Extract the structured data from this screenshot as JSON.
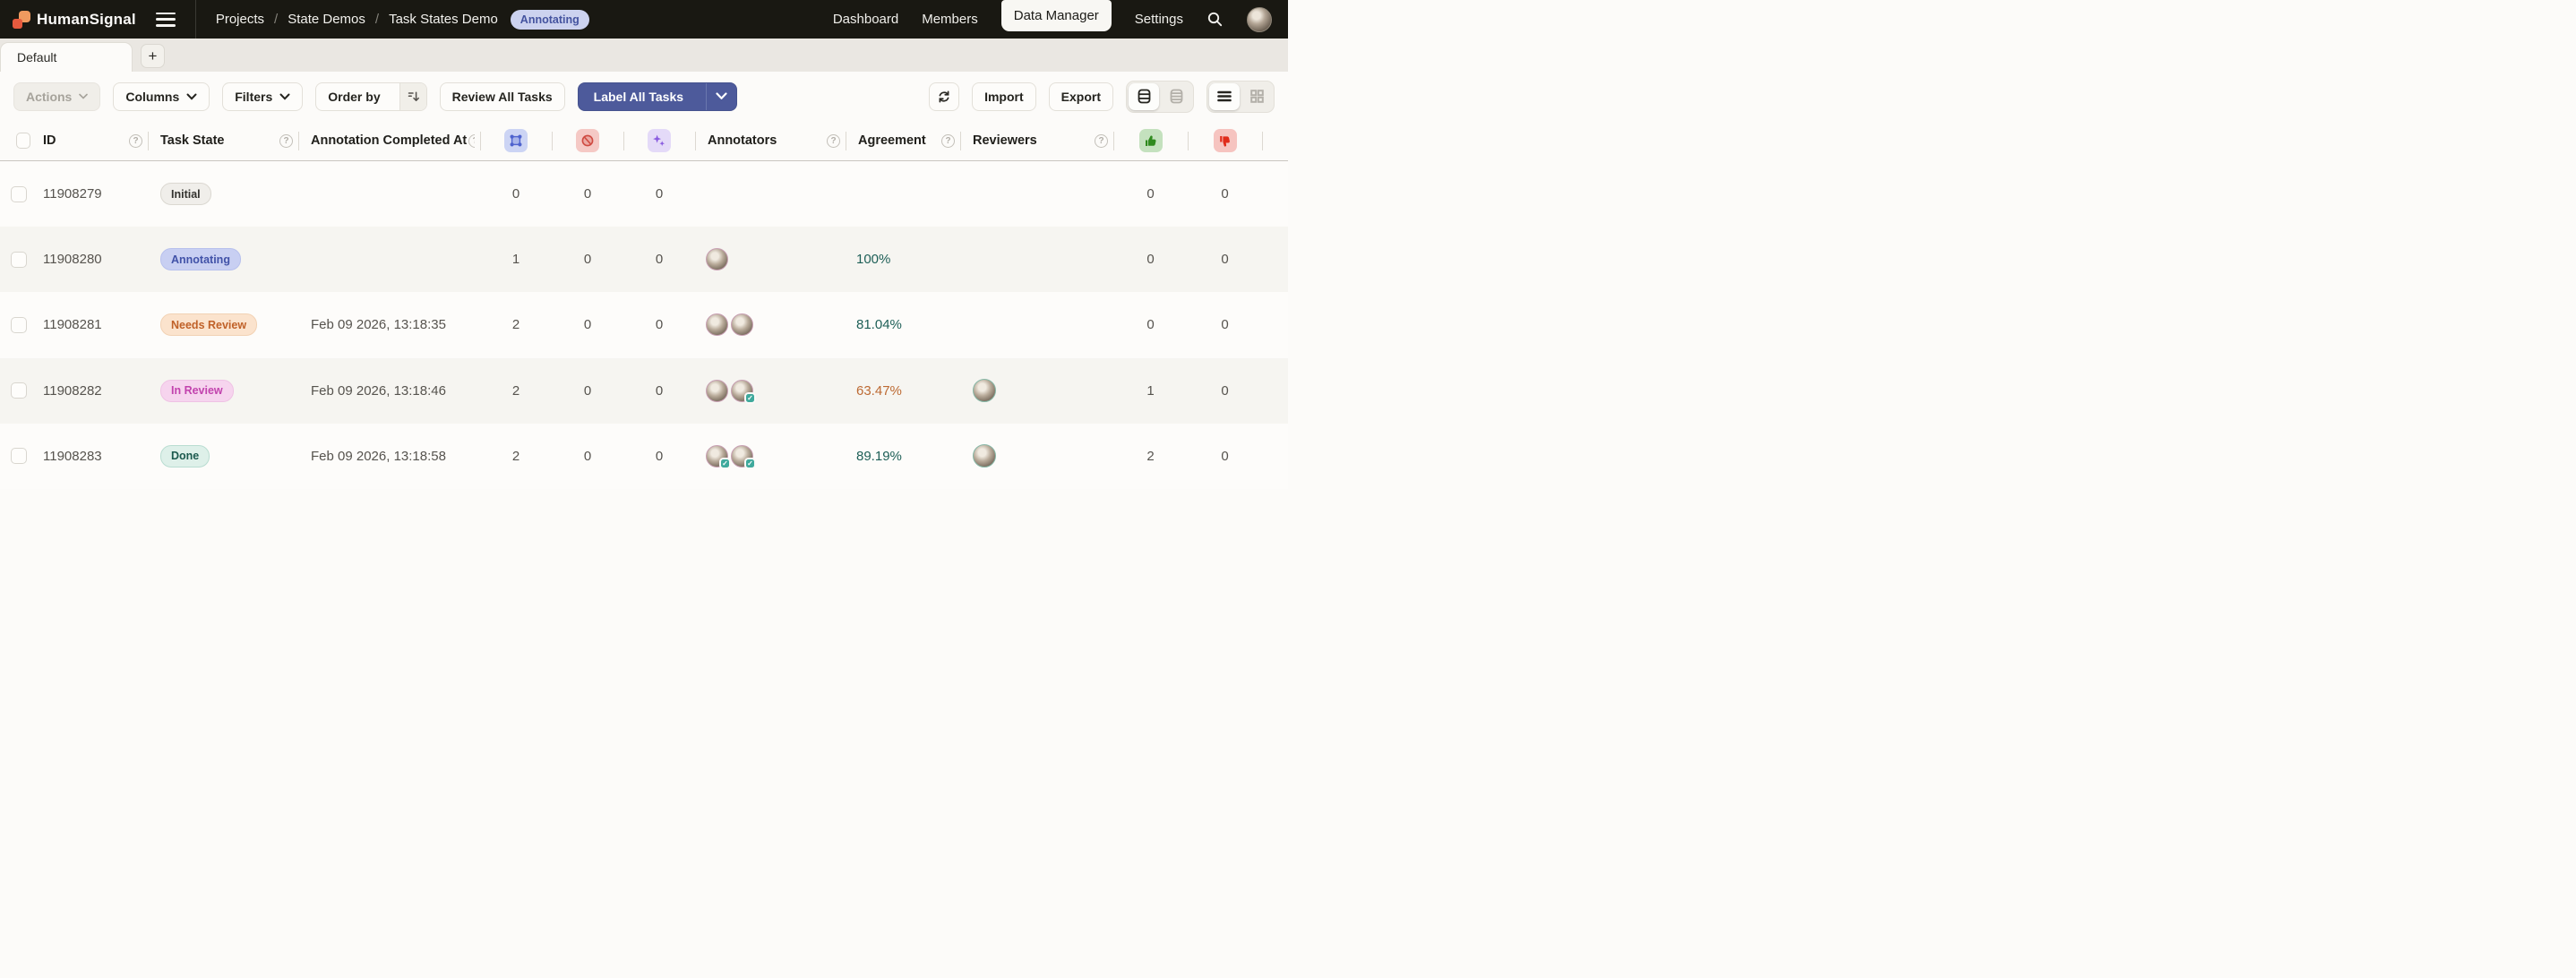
{
  "header": {
    "logo": "HumanSignal",
    "breadcrumb": {
      "items": [
        "Projects",
        "State Demos",
        "Task States Demo"
      ],
      "separator": "/"
    },
    "project_status_badge": "Annotating",
    "nav": {
      "dashboard": "Dashboard",
      "members": "Members",
      "data_manager": "Data Manager",
      "settings": "Settings"
    },
    "icons": [
      "hamburger-icon",
      "search-icon",
      "user-avatar"
    ]
  },
  "tabs": {
    "default_label": "Default",
    "add_label": "+"
  },
  "toolbar": {
    "actions": "Actions",
    "columns": "Columns",
    "filters": "Filters",
    "order_by": "Order by",
    "review_all": "Review All Tasks",
    "label_all": "Label All Tasks",
    "import": "Import",
    "export": "Export",
    "icons": [
      "refresh-icon",
      "sort-icon",
      "row-height-comfort-icon",
      "row-height-compact-icon",
      "list-view-icon",
      "grid-view-icon"
    ],
    "accent_color": "#4d5a9b"
  },
  "table": {
    "columns": {
      "id": "ID",
      "task_state": "Task State",
      "completed_at": "Annotation Completed At",
      "annotations_icon": "bounding-box-icon",
      "skipped_icon": "cancel-icon",
      "predictions_icon": "sparkles-icon",
      "annotators": "Annotators",
      "agreement": "Agreement",
      "reviewers": "Reviewers",
      "accepted_icon": "thumb-up-icon",
      "rejected_icon": "thumb-down-icon"
    },
    "icon_colors": {
      "annotations": "#5064cf",
      "skipped": "#cf4a41",
      "predictions": "#8a5ce0",
      "accepted": "#2f8a1e",
      "rejected": "#e02b1a"
    },
    "agreement_colors": {
      "high": "#1d5f57",
      "low": "#bd6a33"
    },
    "rows": [
      {
        "id": "11908279",
        "state": "Initial",
        "completed_at": "",
        "annotations": "0",
        "skipped": "0",
        "predictions": "0",
        "annotator_avatars": 0,
        "verified": [],
        "agreement": "",
        "reviewer_avatars": 0,
        "accepted": "0",
        "rejected": "0"
      },
      {
        "id": "11908280",
        "state": "Annotating",
        "completed_at": "",
        "annotations": "1",
        "skipped": "0",
        "predictions": "0",
        "annotator_avatars": 1,
        "verified": [
          false
        ],
        "agreement": "100%",
        "reviewer_avatars": 0,
        "accepted": "0",
        "rejected": "0"
      },
      {
        "id": "11908281",
        "state": "Needs Review",
        "completed_at": "Feb 09 2026, 13:18:35",
        "annotations": "2",
        "skipped": "0",
        "predictions": "0",
        "annotator_avatars": 2,
        "verified": [
          false,
          false
        ],
        "agreement": "81.04%",
        "reviewer_avatars": 0,
        "accepted": "0",
        "rejected": "0"
      },
      {
        "id": "11908282",
        "state": "In Review",
        "completed_at": "Feb 09 2026, 13:18:46",
        "annotations": "2",
        "skipped": "0",
        "predictions": "0",
        "annotator_avatars": 2,
        "verified": [
          false,
          true
        ],
        "agreement": "63.47%",
        "reviewer_avatars": 1,
        "accepted": "1",
        "rejected": "0"
      },
      {
        "id": "11908283",
        "state": "Done",
        "completed_at": "Feb 09 2026, 13:18:58",
        "annotations": "2",
        "skipped": "0",
        "predictions": "0",
        "annotator_avatars": 2,
        "verified": [
          true,
          true
        ],
        "agreement": "89.19%",
        "reviewer_avatars": 1,
        "accepted": "2",
        "rejected": "0"
      }
    ]
  }
}
